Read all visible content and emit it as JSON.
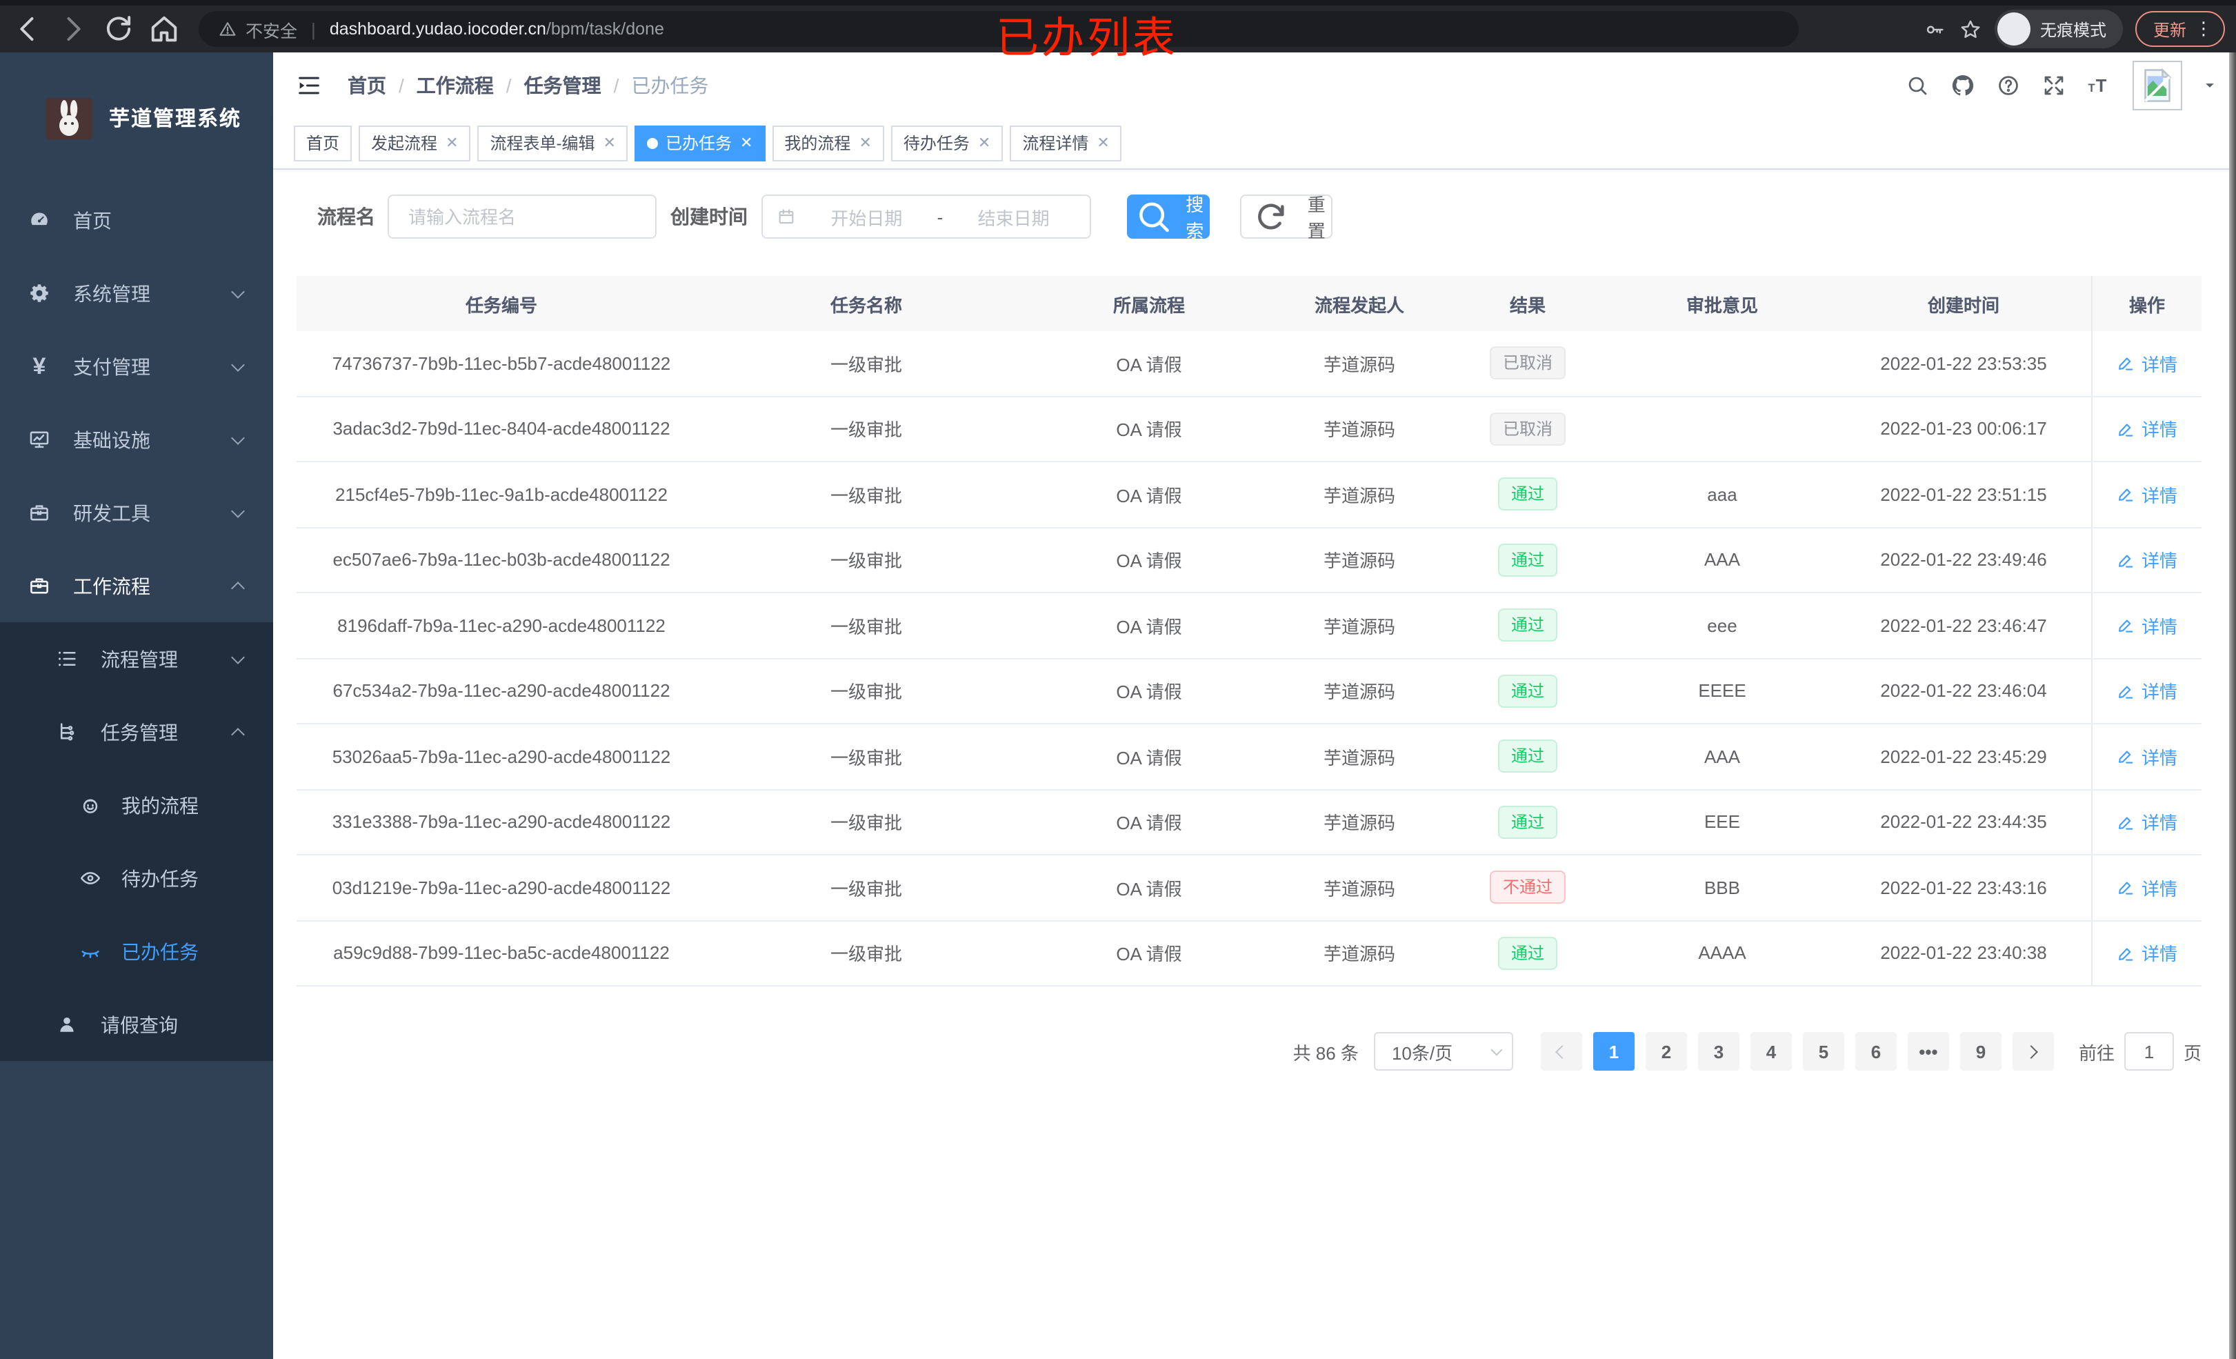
{
  "browser": {
    "security_label": "不安全",
    "url_host": "dashboard.yudao.iocoder.cn",
    "url_path": "/bpm/task/done",
    "incognito_label": "无痕模式",
    "update_label": "更新",
    "more_glyph": "⋮"
  },
  "annotation": {
    "text": "已办列表",
    "color": "#ff2000"
  },
  "sidebar": {
    "title": "芋道管理系统",
    "menu": [
      {
        "name": "home",
        "label": "首页",
        "icon": "dashboard-icon",
        "level": 1,
        "chevron": "",
        "dark": false,
        "active": false,
        "trail": false
      },
      {
        "name": "system",
        "label": "系统管理",
        "icon": "gear-icon",
        "level": 1,
        "chevron": "down",
        "dark": false,
        "active": false,
        "trail": false
      },
      {
        "name": "payment",
        "label": "支付管理",
        "icon": "yen-icon",
        "level": 1,
        "chevron": "down",
        "dark": false,
        "active": false,
        "trail": false
      },
      {
        "name": "infra",
        "label": "基础设施",
        "icon": "monitor-icon",
        "level": 1,
        "chevron": "down",
        "dark": false,
        "active": false,
        "trail": false
      },
      {
        "name": "devtools",
        "label": "研发工具",
        "icon": "toolbox-icon",
        "level": 1,
        "chevron": "down",
        "dark": false,
        "active": false,
        "trail": false
      },
      {
        "name": "workflow",
        "label": "工作流程",
        "icon": "briefcase-icon",
        "level": 1,
        "chevron": "up",
        "dark": false,
        "active": false,
        "trail": true
      },
      {
        "name": "process-mgmt",
        "label": "流程管理",
        "icon": "list-icon",
        "level": 2,
        "chevron": "down",
        "dark": true,
        "active": false,
        "trail": false
      },
      {
        "name": "task-mgmt",
        "label": "任务管理",
        "icon": "tree-icon",
        "level": 2,
        "chevron": "up",
        "dark": true,
        "active": false,
        "trail": false
      },
      {
        "name": "my-process",
        "label": "我的流程",
        "icon": "face-icon",
        "level": 3,
        "chevron": "",
        "dark": true,
        "active": false,
        "trail": false
      },
      {
        "name": "todo-tasks",
        "label": "待办任务",
        "icon": "eye-icon",
        "level": 3,
        "chevron": "",
        "dark": true,
        "active": false,
        "trail": false
      },
      {
        "name": "done-tasks",
        "label": "已办任务",
        "icon": "eye-closed-icon",
        "level": 3,
        "chevron": "",
        "dark": true,
        "active": true,
        "trail": false
      },
      {
        "name": "leave-query",
        "label": "请假查询",
        "icon": "user-icon",
        "level": 2,
        "chevron": "",
        "dark": true,
        "active": false,
        "trail": false
      }
    ]
  },
  "breadcrumb": {
    "items": [
      "首页",
      "工作流程",
      "任务管理",
      "已办任务"
    ],
    "separator": "/"
  },
  "tabs": [
    {
      "name": "home",
      "label": "首页",
      "closable": false,
      "active": false
    },
    {
      "name": "start-process",
      "label": "发起流程",
      "closable": true,
      "active": false
    },
    {
      "name": "form-edit",
      "label": "流程表单-编辑",
      "closable": true,
      "active": false
    },
    {
      "name": "done-tasks",
      "label": "已办任务",
      "closable": true,
      "active": true
    },
    {
      "name": "my-process",
      "label": "我的流程",
      "closable": true,
      "active": false
    },
    {
      "name": "todo-tasks",
      "label": "待办任务",
      "closable": true,
      "active": false
    },
    {
      "name": "process-detail",
      "label": "流程详情",
      "closable": true,
      "active": false
    }
  ],
  "filters": {
    "name_label": "流程名",
    "name_placeholder": "请输入流程名",
    "time_label": "创建时间",
    "start_placeholder": "开始日期",
    "range_separator": "-",
    "end_placeholder": "结束日期",
    "search_label": "搜索",
    "reset_label": "重置"
  },
  "table": {
    "columns": [
      "任务编号",
      "任务名称",
      "所属流程",
      "流程发起人",
      "结果",
      "审批意见",
      "创建时间",
      "操作"
    ],
    "action_label": "详情",
    "rows": [
      {
        "id": "74736737-7b9b-11ec-b5b7-acde48001122",
        "name": "一级审批",
        "process": "OA 请假",
        "starter": "芋道源码",
        "result": "已取消",
        "result_type": "info",
        "comment": "",
        "created": "2022-01-22 23:53:35"
      },
      {
        "id": "3adac3d2-7b9d-11ec-8404-acde48001122",
        "name": "一级审批",
        "process": "OA 请假",
        "starter": "芋道源码",
        "result": "已取消",
        "result_type": "info",
        "comment": "",
        "created": "2022-01-23 00:06:17"
      },
      {
        "id": "215cf4e5-7b9b-11ec-9a1b-acde48001122",
        "name": "一级审批",
        "process": "OA 请假",
        "starter": "芋道源码",
        "result": "通过",
        "result_type": "success",
        "comment": "aaa",
        "created": "2022-01-22 23:51:15"
      },
      {
        "id": "ec507ae6-7b9a-11ec-b03b-acde48001122",
        "name": "一级审批",
        "process": "OA 请假",
        "starter": "芋道源码",
        "result": "通过",
        "result_type": "success",
        "comment": "AAA",
        "created": "2022-01-22 23:49:46"
      },
      {
        "id": "8196daff-7b9a-11ec-a290-acde48001122",
        "name": "一级审批",
        "process": "OA 请假",
        "starter": "芋道源码",
        "result": "通过",
        "result_type": "success",
        "comment": "eee",
        "created": "2022-01-22 23:46:47"
      },
      {
        "id": "67c534a2-7b9a-11ec-a290-acde48001122",
        "name": "一级审批",
        "process": "OA 请假",
        "starter": "芋道源码",
        "result": "通过",
        "result_type": "success",
        "comment": "EEEE",
        "created": "2022-01-22 23:46:04"
      },
      {
        "id": "53026aa5-7b9a-11ec-a290-acde48001122",
        "name": "一级审批",
        "process": "OA 请假",
        "starter": "芋道源码",
        "result": "通过",
        "result_type": "success",
        "comment": "AAA",
        "created": "2022-01-22 23:45:29"
      },
      {
        "id": "331e3388-7b9a-11ec-a290-acde48001122",
        "name": "一级审批",
        "process": "OA 请假",
        "starter": "芋道源码",
        "result": "通过",
        "result_type": "success",
        "comment": "EEE",
        "created": "2022-01-22 23:44:35"
      },
      {
        "id": "03d1219e-7b9a-11ec-a290-acde48001122",
        "name": "一级审批",
        "process": "OA 请假",
        "starter": "芋道源码",
        "result": "不通过",
        "result_type": "danger",
        "comment": "BBB",
        "created": "2022-01-22 23:43:16"
      },
      {
        "id": "a59c9d88-7b99-11ec-ba5c-acde48001122",
        "name": "一级审批",
        "process": "OA 请假",
        "starter": "芋道源码",
        "result": "通过",
        "result_type": "success",
        "comment": "AAAA",
        "created": "2022-01-22 23:40:38"
      }
    ]
  },
  "pagination": {
    "total_label": "共 86 条",
    "page_size_label": "10条/页",
    "pages": [
      {
        "label": "1",
        "active": true
      },
      {
        "label": "2",
        "active": false
      },
      {
        "label": "3",
        "active": false
      },
      {
        "label": "4",
        "active": false
      },
      {
        "label": "5",
        "active": false
      },
      {
        "label": "6",
        "active": false
      },
      {
        "label": "•••",
        "active": false
      },
      {
        "label": "9",
        "active": false
      }
    ],
    "goto_label": "前往",
    "goto_value": "1",
    "page_unit": "页"
  },
  "colors": {
    "primary": "#409eff",
    "sidebar_bg": "#304156",
    "sidebar_submenu_bg": "#1f2d3d",
    "tag_success_text": "#13ce66",
    "tag_danger_text": "#f56c6c",
    "tag_info_text": "#909399"
  }
}
